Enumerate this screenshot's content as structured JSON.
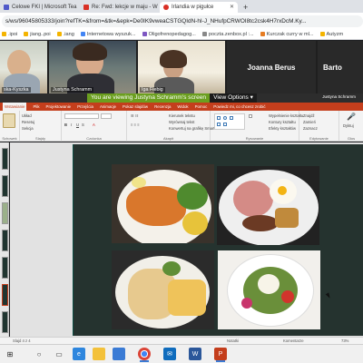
{
  "browser": {
    "tabs": [
      {
        "label": "Celowe FKI | Microsoft Tea",
        "fav_color": "#5059c9",
        "active": false
      },
      {
        "label": "Re: Fwd: lekcje w maju - WP Po",
        "fav_color": "#d93025",
        "active": false
      },
      {
        "label": "Irlandia w pigułce",
        "fav_color": "#d93025",
        "active": true
      }
    ],
    "new_tab_label": "+",
    "url": "s/ws/96045805333/join?refTK=&from=&tk=&epk=De0IK9vweaCSTGQIdN-hI-J_NHufpCRWOI8tc2csk4H7rxDcM.Ky..."
  },
  "bookmarks": [
    ".ipoi",
    "jiang..poi",
    ".iang",
    "Internetowa wyszuk...",
    "Oligofrenopedagog...",
    "poczta.zenbox.pl :...",
    "Kurczak curry w ml...",
    "Autyzm"
  ],
  "participants": [
    {
      "name": "ska-Kyszka",
      "type": "camera"
    },
    {
      "name": "Justyna Schramm",
      "type": "camera"
    },
    {
      "name": "Iga Fiebig",
      "type": "camera"
    },
    {
      "name": "Joanna Berus",
      "type": "avatar"
    },
    {
      "name": "Barto",
      "type": "avatar"
    }
  ],
  "share": {
    "banner_text": "You are viewing Justyna Schramm's screen",
    "view_options_label": "View Options",
    "view_options_chevron": "▾",
    "ppt_user": "Justyna Schramm"
  },
  "ribbon": {
    "tabs": [
      "Wstawianie",
      "Plik",
      "Projektowanie",
      "Przejścia",
      "Animacje",
      "Pokaz slajdów",
      "Recenzja",
      "Widok",
      "Pomoc",
      "Powiedz mi, co chcesz zrobić"
    ],
    "active_tab_index": 0,
    "slides_group": {
      "new_label": "Nowy slajd",
      "layout": "Układ",
      "reset": "Resetuj",
      "section": "Sekcja",
      "label": "Slajdy"
    },
    "clipboard_label": "Schowek",
    "font_group": {
      "label": "Czcionka"
    },
    "paragraph_group": {
      "label": "Akapit",
      "items": [
        "Kierunek tekstu",
        "Wyrównaj tekst",
        "Konwertuj na grafikę SmartArt"
      ]
    },
    "drawing_group": {
      "label": "Rysowanie",
      "items": [
        "Wypełnienie kształtu",
        "Kontury kształtu",
        "Efekty kształtów"
      ]
    },
    "editing_group": {
      "label": "Edytowanie",
      "items": [
        "Znajdź",
        "Zamień",
        "Zaznacz"
      ]
    },
    "dictate_label": "Dyktuj",
    "voice_label": "Głos"
  },
  "status": {
    "notes": "Notatki",
    "comments": "Komentarze",
    "left": "Slajd 4 z 4",
    "zoom": "73%"
  },
  "colors": {
    "ppt_accent": "#c43e1c",
    "teams_banner": "#6b9f1f",
    "slide_bg": "#25332f"
  },
  "taskbar": {
    "icons": [
      "windows-start-icon",
      "search-icon",
      "task-view-icon",
      "edge-icon",
      "explorer-icon",
      "store-icon",
      "chrome-icon",
      "mail-icon",
      "word-icon",
      "powerpoint-icon"
    ]
  }
}
